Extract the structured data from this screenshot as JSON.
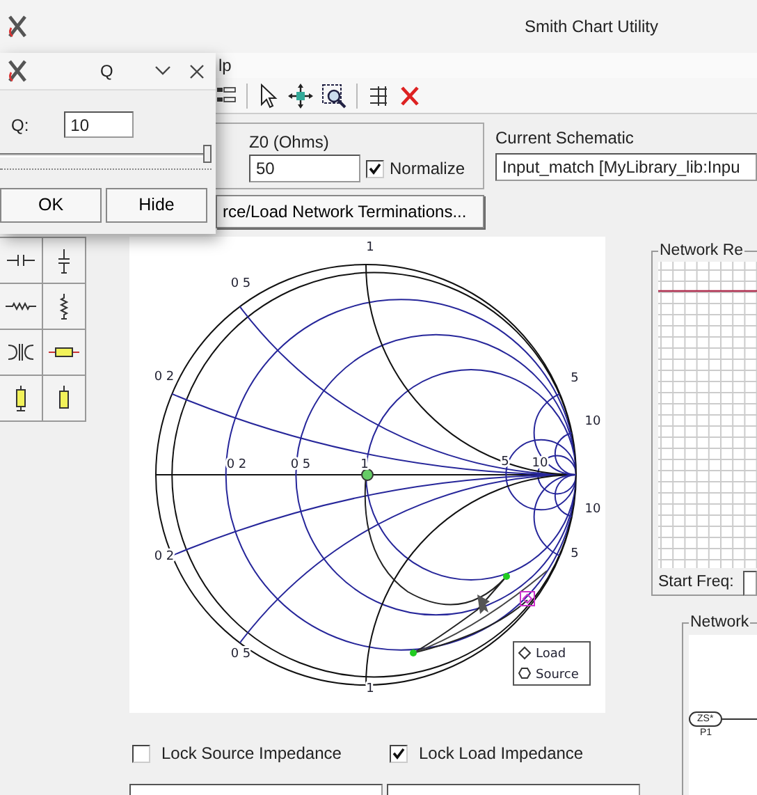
{
  "window": {
    "title": "Smith Chart Utility"
  },
  "menu": [
    "lp"
  ],
  "z0": {
    "label": "Z0 (Ohms)",
    "value": "50",
    "normalize": {
      "label": "Normalize",
      "checked": true
    }
  },
  "schematic": {
    "label": "Current Schematic",
    "value": "Input_match [MyLibrary_lib:Inpu"
  },
  "terminations_button": "rce/Load Network Terminations...",
  "smith_chart": {
    "labels": [
      "1",
      "0 5",
      "0 2",
      "0 2",
      "0 5",
      "1",
      "5",
      "10",
      "5",
      "10",
      "10",
      "5",
      "0 2",
      "0 5",
      "1"
    ],
    "legend": [
      "Load",
      "Source"
    ]
  },
  "network_response": {
    "title": "Network Re",
    "start_freq_label": "Start Freq:"
  },
  "network": {
    "title": "Network",
    "port_symbol": "ZS*",
    "port_label": "P1"
  },
  "locks": [
    {
      "label": "Lock Source Impedance",
      "checked": false
    },
    {
      "label": "Lock Load Impedance",
      "checked": true
    }
  ],
  "q_dialog": {
    "title": "Q",
    "field_label": "Q:",
    "value": "10",
    "level": 1.0,
    "buttons": [
      "OK",
      "Hide"
    ]
  }
}
